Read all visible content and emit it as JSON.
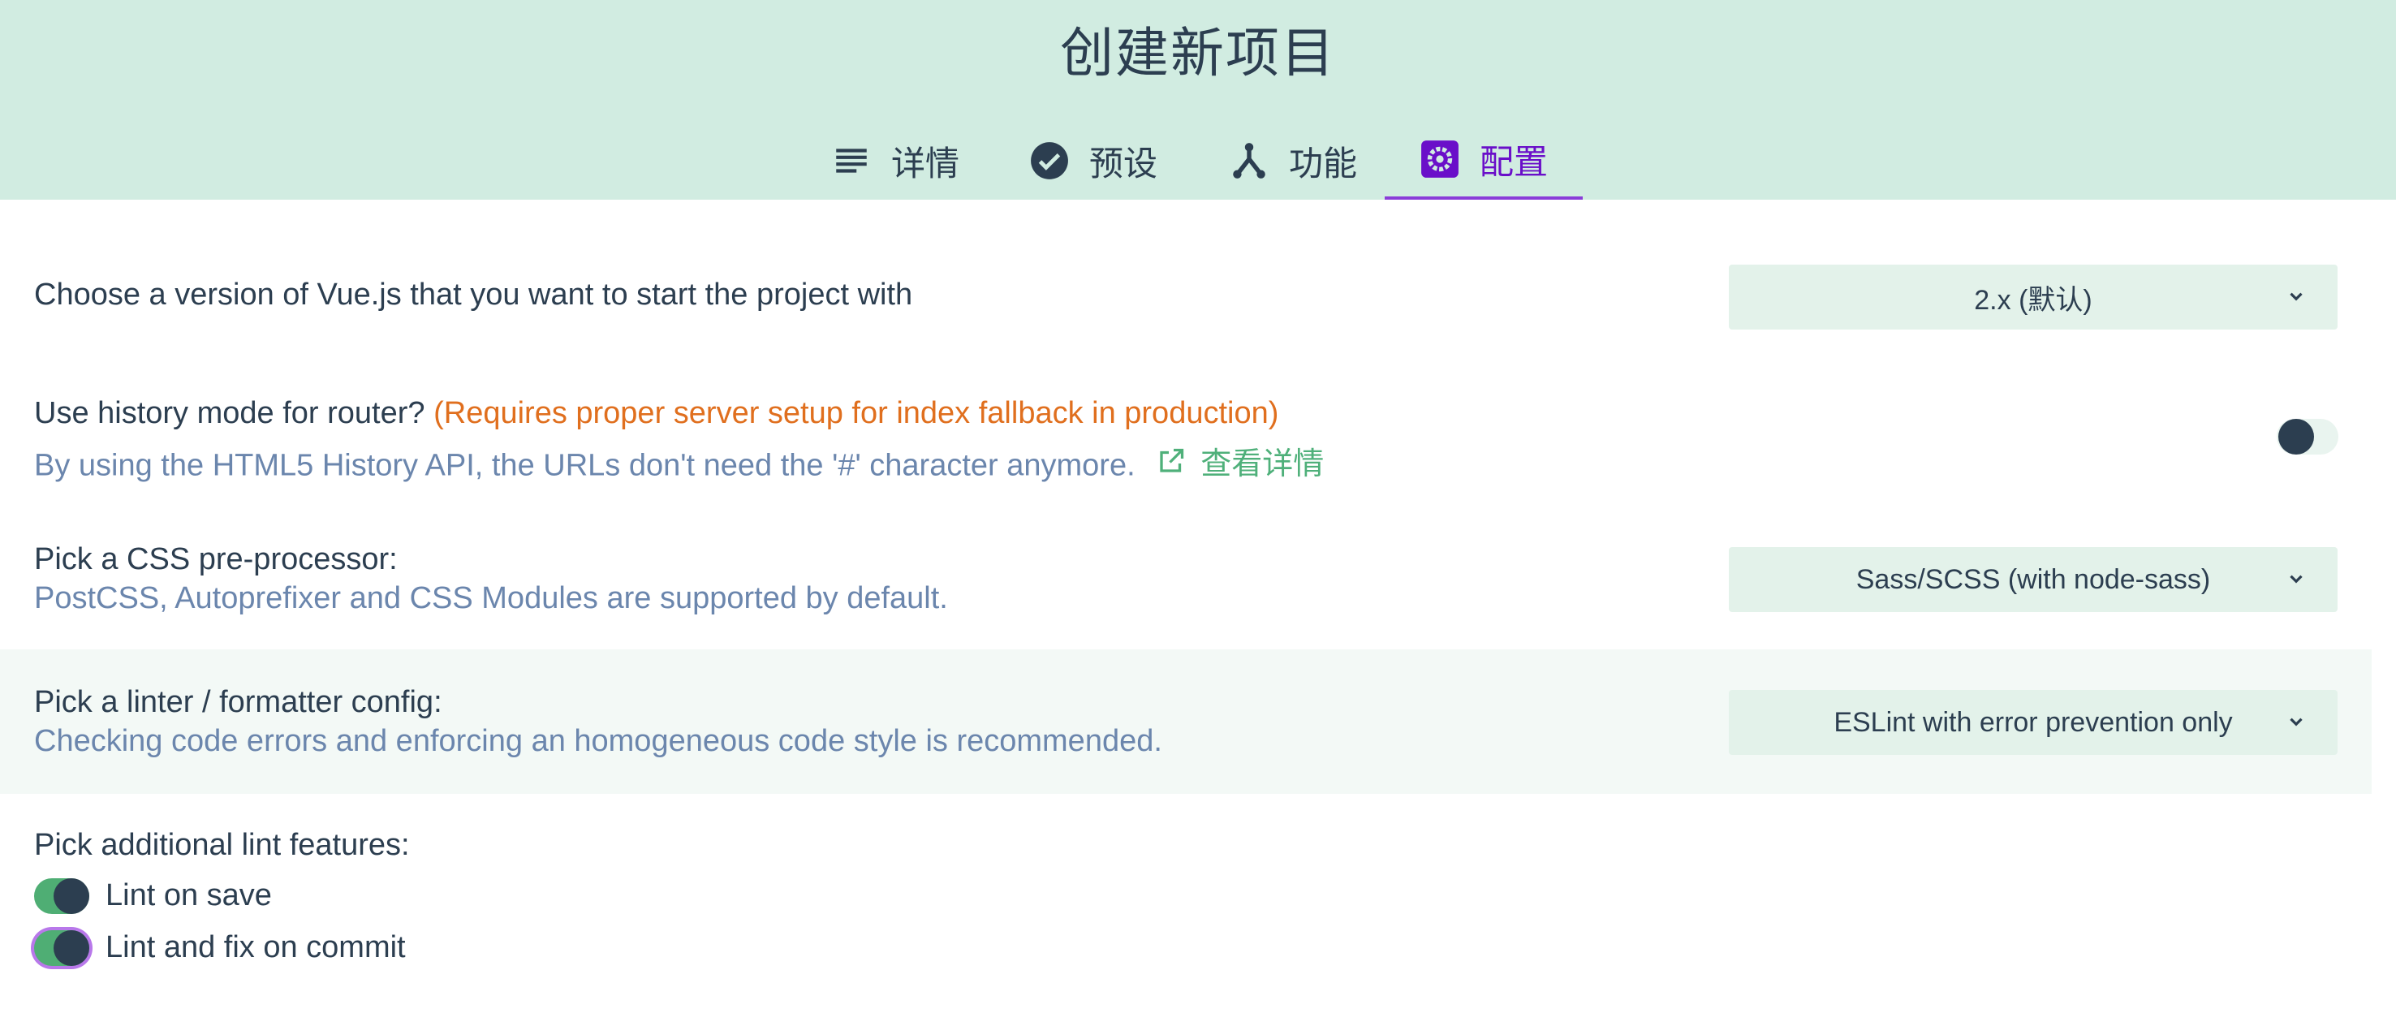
{
  "header": {
    "title": "创建新项目",
    "tabs": [
      {
        "label": "详情",
        "icon": "list-icon"
      },
      {
        "label": "预设",
        "icon": "check-circle-icon"
      },
      {
        "label": "功能",
        "icon": "fork-icon"
      },
      {
        "label": "配置",
        "icon": "settings-gear-icon",
        "active": true
      }
    ]
  },
  "prompts": {
    "vue_version": {
      "question": "Choose a version of Vue.js that you want to start the project with",
      "value": "2.x (默认)"
    },
    "history_mode": {
      "question": "Use history mode for router?",
      "warning": "(Requires proper server setup for index fallback in production)",
      "description": "By using the HTML5 History API, the URLs don't need the '#' character anymore.",
      "link_label": "查看详情",
      "enabled": false
    },
    "css_preprocessor": {
      "question": "Pick a CSS pre-processor:",
      "description": "PostCSS, Autoprefixer and CSS Modules are supported by default.",
      "value": "Sass/SCSS (with node-sass)"
    },
    "linter": {
      "question": "Pick a linter / formatter config:",
      "description": "Checking code errors and enforcing an homogeneous code style is recommended.",
      "value": "ESLint with error prevention only"
    },
    "lint_features": {
      "question": "Pick additional lint features:",
      "options": [
        {
          "label": "Lint on save",
          "enabled": true
        },
        {
          "label": "Lint and fix on commit",
          "enabled": true
        }
      ]
    }
  },
  "colors": {
    "header_bg": "#d1ece1",
    "accent": "#6a0fc9",
    "warning": "#e06f1e",
    "link": "#4fb07a",
    "toggle_on": "#4fae74"
  }
}
